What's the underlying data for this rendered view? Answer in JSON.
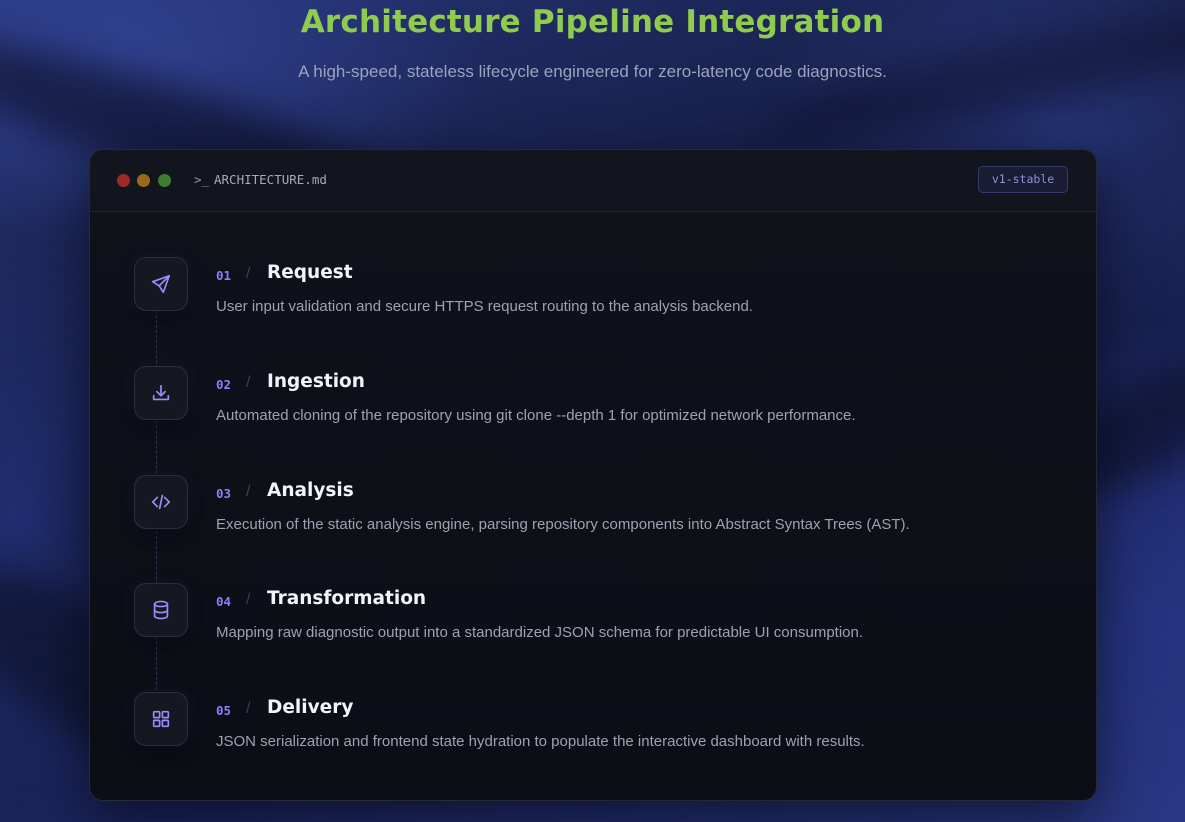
{
  "hero": {
    "title": "Architecture Pipeline Integration",
    "subtitle": "A high-speed, stateless lifecycle engineered for zero-latency code diagnostics."
  },
  "window": {
    "prompt_symbol": ">_",
    "filename": "ARCHITECTURE.md",
    "version_badge": "v1-stable"
  },
  "steps": [
    {
      "number": "01",
      "separator": "/",
      "title": "Request",
      "description": "User input validation and secure HTTPS request routing to the analysis backend.",
      "icon": "send-icon"
    },
    {
      "number": "02",
      "separator": "/",
      "title": "Ingestion",
      "description": "Automated cloning of the repository using git clone --depth 1 for optimized network performance.",
      "icon": "download-icon"
    },
    {
      "number": "03",
      "separator": "/",
      "title": "Analysis",
      "description": "Execution of the static analysis engine, parsing repository components into Abstract Syntax Trees (AST).",
      "icon": "code-icon"
    },
    {
      "number": "04",
      "separator": "/",
      "title": "Transformation",
      "description": "Mapping raw diagnostic output into a standardized JSON schema for predictable UI consumption.",
      "icon": "database-icon"
    },
    {
      "number": "05",
      "separator": "/",
      "title": "Delivery",
      "description": "JSON serialization and frontend state hydration to populate the interactive dashboard with results.",
      "icon": "grid-icon"
    }
  ],
  "colors": {
    "title_accent": "#8fcb4f",
    "step_accent": "#8d7dff",
    "icon_stroke": "#9b8cff",
    "window_bg": "#0e1018"
  }
}
